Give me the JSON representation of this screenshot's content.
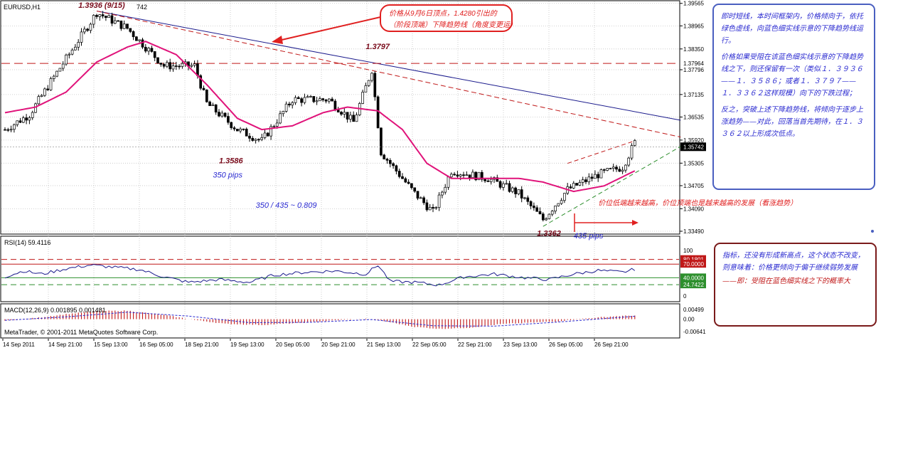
{
  "window_title": "EURUSD,H1",
  "tick_volume": "742",
  "copyright": "MetaTrader, © 2001-2011 MetaQuotes Software Corp.",
  "colors": {
    "bull_body": "#ffffff",
    "bear_body": "#000000",
    "ma_line": "#e0137a",
    "trend_solid": "#1a1a8c",
    "trend_dashed": "#c01818",
    "support_line": "#2d8f2d",
    "label_dark_red": "#7a0c1c",
    "label_blue": "#2a2ad0",
    "callout_red": "#e02020"
  },
  "chart_data": [
    {
      "type": "candlestick",
      "title": "EURUSD,H1",
      "ylim": [
        1.3349,
        1.3956
      ],
      "y_ticks": [
        "1.39565",
        "1.38965",
        "1.38350",
        "1.37796",
        "1.37135",
        "1.36535",
        "1.35920",
        "1.35305",
        "1.34705",
        "1.34090",
        "1.33490"
      ],
      "x_ticks": [
        "14 Sep 2011",
        "14 Sep 21:00",
        "15 Sep 13:00",
        "16 Sep 05:00",
        "18 Sep 21:00",
        "19 Sep 13:00",
        "20 Sep 05:00",
        "20 Sep 21:00",
        "21 Sep 13:00",
        "22 Sep 05:00",
        "22 Sep 21:00",
        "23 Sep 13:00",
        "26 Sep 05:00",
        "26 Sep 21:00"
      ],
      "current_price": "1.35742",
      "level_tag": "1.37964",
      "anchors": [
        {
          "i": 0,
          "p": 1.362
        },
        {
          "i": 8,
          "p": 1.366
        },
        {
          "i": 16,
          "p": 1.376
        },
        {
          "i": 25,
          "p": 1.387
        },
        {
          "i": 30,
          "p": 1.3932
        },
        {
          "i": 40,
          "p": 1.389
        },
        {
          "i": 52,
          "p": 1.379
        },
        {
          "i": 62,
          "p": 1.379
        },
        {
          "i": 66,
          "p": 1.369
        },
        {
          "i": 76,
          "p": 1.362
        },
        {
          "i": 84,
          "p": 1.359
        },
        {
          "i": 94,
          "p": 1.37
        },
        {
          "i": 106,
          "p": 1.37
        },
        {
          "i": 114,
          "p": 1.364
        },
        {
          "i": 120,
          "p": 1.378
        },
        {
          "i": 123,
          "p": 1.356
        },
        {
          "i": 134,
          "p": 1.345
        },
        {
          "i": 140,
          "p": 1.34
        },
        {
          "i": 146,
          "p": 1.351
        },
        {
          "i": 158,
          "p": 1.349
        },
        {
          "i": 168,
          "p": 1.345
        },
        {
          "i": 176,
          "p": 1.338
        },
        {
          "i": 184,
          "p": 1.346
        },
        {
          "i": 194,
          "p": 1.35
        },
        {
          "i": 202,
          "p": 1.352
        },
        {
          "i": 206,
          "p": 1.3585
        }
      ],
      "ma_points": [
        {
          "i": 0,
          "p": 1.3665
        },
        {
          "i": 10,
          "p": 1.368
        },
        {
          "i": 20,
          "p": 1.372
        },
        {
          "i": 30,
          "p": 1.38
        },
        {
          "i": 40,
          "p": 1.384
        },
        {
          "i": 46,
          "p": 1.3855
        },
        {
          "i": 56,
          "p": 1.382
        },
        {
          "i": 66,
          "p": 1.374
        },
        {
          "i": 76,
          "p": 1.365
        },
        {
          "i": 84,
          "p": 1.362
        },
        {
          "i": 94,
          "p": 1.363
        },
        {
          "i": 104,
          "p": 1.3665
        },
        {
          "i": 112,
          "p": 1.368
        },
        {
          "i": 122,
          "p": 1.367
        },
        {
          "i": 130,
          "p": 1.362
        },
        {
          "i": 138,
          "p": 1.353
        },
        {
          "i": 146,
          "p": 1.349
        },
        {
          "i": 158,
          "p": 1.349
        },
        {
          "i": 168,
          "p": 1.349
        },
        {
          "i": 176,
          "p": 1.348
        },
        {
          "i": 186,
          "p": 1.3455
        },
        {
          "i": 196,
          "p": 1.347
        },
        {
          "i": 206,
          "p": 1.351
        }
      ],
      "trend_solid": {
        "i1": 30,
        "p1": 1.3936,
        "i2": 221,
        "p2": 1.3645
      },
      "trend_dashed": {
        "i1": 30,
        "p1": 1.3936,
        "i2": 221,
        "p2": 1.36
      },
      "resist_level": 1.37964,
      "channel_upper": {
        "i1": 184,
        "p1": 1.353,
        "i2": 206,
        "p2": 1.359
      },
      "support": {
        "i1": 176,
        "p1": 1.3362,
        "i2": 221,
        "p2": 1.3575
      },
      "annotations": [
        {
          "text": "1.3936  (9/15)",
          "i": 24,
          "p": 1.3945,
          "style": "dark"
        },
        {
          "text": "1.3797",
          "i": 118,
          "p": 1.3835,
          "style": "dark"
        },
        {
          "text": "1.3586",
          "i": 70,
          "p": 1.353,
          "style": "dark"
        },
        {
          "text": "1.3362",
          "i": 174,
          "p": 1.3337,
          "style": "dark"
        },
        {
          "text": "350  pips",
          "i": 68,
          "p": 1.3492,
          "style": "blue"
        },
        {
          "text": "350 / 435  ~  0.809",
          "i": 82,
          "p": 1.3412,
          "style": "blue"
        },
        {
          "text": "435  pips",
          "i": 186,
          "p": 1.333,
          "style": "blue"
        },
        {
          "text": "价位低端越来越高，价位顶端也是越来越高的发展（看涨趋势）",
          "i": 194,
          "p": 1.3418,
          "style": "red"
        }
      ],
      "callout": {
        "line1": "价格从9月6日顶点，1.4280引出的",
        "line2": "（阶段顶端）下降趋势线（角度变更运）"
      }
    },
    {
      "type": "line",
      "title": "RSI(14) 59.4116",
      "ylim": [
        0,
        100
      ],
      "y_ticks": [
        "100",
        "80.1801",
        "70.0000",
        "40.0000",
        "24.7422",
        "0"
      ],
      "levels": [
        80.18,
        70,
        40,
        24.74
      ],
      "anchors": [
        {
          "i": 0,
          "p": 42
        },
        {
          "i": 6,
          "p": 55
        },
        {
          "i": 12,
          "p": 48
        },
        {
          "i": 20,
          "p": 60
        },
        {
          "i": 28,
          "p": 68
        },
        {
          "i": 34,
          "p": 64
        },
        {
          "i": 44,
          "p": 58
        },
        {
          "i": 52,
          "p": 42
        },
        {
          "i": 60,
          "p": 30
        },
        {
          "i": 70,
          "p": 36
        },
        {
          "i": 80,
          "p": 30
        },
        {
          "i": 88,
          "p": 46
        },
        {
          "i": 98,
          "p": 52
        },
        {
          "i": 108,
          "p": 55
        },
        {
          "i": 118,
          "p": 48
        },
        {
          "i": 122,
          "p": 68
        },
        {
          "i": 126,
          "p": 32
        },
        {
          "i": 134,
          "p": 30
        },
        {
          "i": 142,
          "p": 24
        },
        {
          "i": 150,
          "p": 42
        },
        {
          "i": 160,
          "p": 48
        },
        {
          "i": 170,
          "p": 40
        },
        {
          "i": 178,
          "p": 36
        },
        {
          "i": 186,
          "p": 48
        },
        {
          "i": 194,
          "p": 56
        },
        {
          "i": 202,
          "p": 52
        },
        {
          "i": 206,
          "p": 59
        }
      ]
    },
    {
      "type": "bar",
      "title": "MACD(12,26,9) 0.001895 0.001481",
      "ylim": [
        -0.0064,
        0.005
      ],
      "y_ticks": [
        "0.00499",
        "0.00",
        "-0.00641"
      ],
      "anchors": [
        {
          "i": 0,
          "p": -0.0008
        },
        {
          "i": 10,
          "p": 0.0006
        },
        {
          "i": 20,
          "p": 0.0026
        },
        {
          "i": 30,
          "p": 0.0042
        },
        {
          "i": 40,
          "p": 0.0044
        },
        {
          "i": 52,
          "p": 0.0022
        },
        {
          "i": 62,
          "p": -0.0004
        },
        {
          "i": 72,
          "p": -0.0024
        },
        {
          "i": 84,
          "p": -0.003
        },
        {
          "i": 96,
          "p": -0.002
        },
        {
          "i": 108,
          "p": -0.0006
        },
        {
          "i": 118,
          "p": 0.0002
        },
        {
          "i": 124,
          "p": -0.001
        },
        {
          "i": 134,
          "p": -0.004
        },
        {
          "i": 142,
          "p": -0.005
        },
        {
          "i": 152,
          "p": -0.0044
        },
        {
          "i": 162,
          "p": -0.0026
        },
        {
          "i": 172,
          "p": -0.0018
        },
        {
          "i": 180,
          "p": -0.0012
        },
        {
          "i": 190,
          "p": 0.0004
        },
        {
          "i": 200,
          "p": 0.0016
        },
        {
          "i": 206,
          "p": 0.0019
        }
      ],
      "signal_anchors": [
        {
          "i": 0,
          "p": -0.0006
        },
        {
          "i": 20,
          "p": 0.0012
        },
        {
          "i": 40,
          "p": 0.0036
        },
        {
          "i": 60,
          "p": 0.0016
        },
        {
          "i": 80,
          "p": -0.0018
        },
        {
          "i": 100,
          "p": -0.0016
        },
        {
          "i": 120,
          "p": -0.0002
        },
        {
          "i": 140,
          "p": -0.0034
        },
        {
          "i": 160,
          "p": -0.0036
        },
        {
          "i": 180,
          "p": -0.0016
        },
        {
          "i": 206,
          "p": 0.0015
        }
      ]
    }
  ],
  "notes": {
    "right_para1": "即时短线，本时间框架内，价格倾向于，依托绿色虚线，向蓝色细实线示意的下降趋势线运行。",
    "right_para2": "价格如果受阻在该蓝色细实线示意的下降趋势线之下，则还保留有一次（类似１．３９３６——１．３５８６；或者１．３７９７——１．３３６２这样规模）向下的下跌过程；",
    "right_para3": "反之，突破上述下降趋势线，将倾向于逐步上涨趋势——对此，回落当首先期待，在１．３３６２以上形成次低点。",
    "rsi_para": "指标，还没有形成新高点，这个状态不改变，则意味着：价格更倾向于偏于继续弱势发展",
    "rsi_conclusion": "——即：受阻在蓝色细实线之下的概率大"
  }
}
